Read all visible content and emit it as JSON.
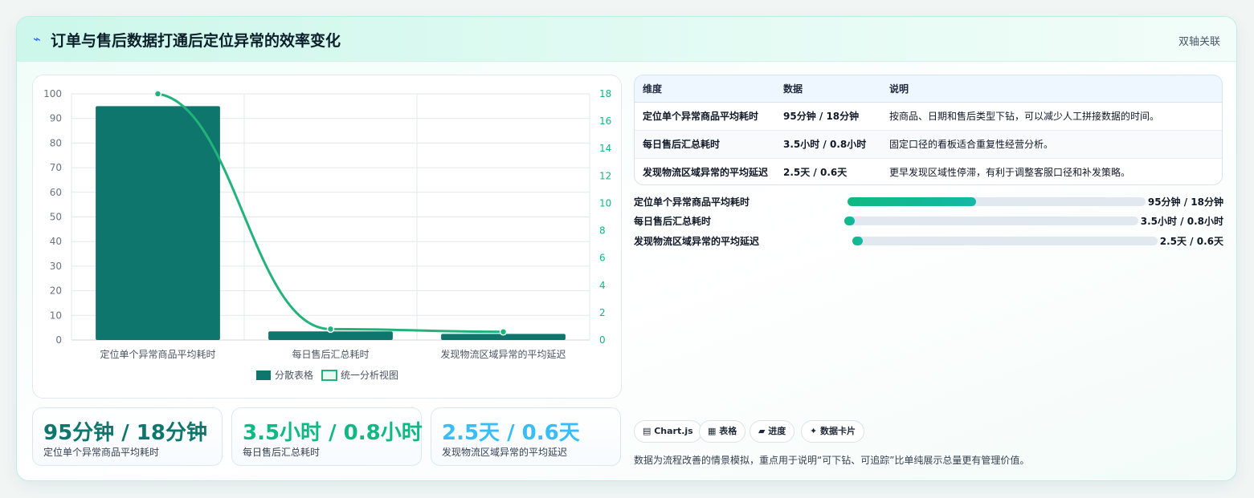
{
  "header": {
    "icon": "lightning-icon",
    "title": "订单与售后数据打通后定位异常的效率变化",
    "tag": "双轴关联"
  },
  "chart_data": {
    "type": "bar",
    "categories": [
      "定位单个异常商品平均耗时",
      "每日售后汇总耗时",
      "发现物流区域异常的平均延迟"
    ],
    "series": [
      {
        "name": "分散表格",
        "type": "bar",
        "axis": "left",
        "values": [
          95,
          3.5,
          2.5
        ],
        "color": "#0f766e"
      },
      {
        "name": "统一分析视图",
        "type": "line",
        "axis": "right",
        "values": [
          18,
          0.8,
          0.6
        ],
        "color": "#22b37a"
      }
    ],
    "y_left": {
      "min": 0,
      "max": 100,
      "ticks": [
        0,
        10,
        20,
        30,
        40,
        50,
        60,
        70,
        80,
        90,
        100
      ]
    },
    "y_right": {
      "min": 0,
      "max": 18,
      "ticks": [
        0,
        2,
        4,
        6,
        8,
        10,
        12,
        14,
        16,
        18
      ]
    },
    "legend": "bottom",
    "grid": true
  },
  "stats": [
    {
      "value": "95分钟 / 18分钟",
      "label": "定位单个异常商品平均耗时",
      "color": "#0f766e"
    },
    {
      "value": "3.5小时 / 0.8小时",
      "label": "每日售后汇总耗时",
      "color": "#10b981"
    },
    {
      "value": "2.5天 / 0.6天",
      "label": "发现物流区域异常的平均延迟",
      "color": "#38bdf8"
    }
  ],
  "table": {
    "headers": [
      "维度",
      "数据",
      "说明"
    ],
    "rows": [
      [
        "定位单个异常商品平均耗时",
        "95分钟 / 18分钟",
        "按商品、日期和售后类型下钻，可以减少人工拼接数据的时间。"
      ],
      [
        "每日售后汇总耗时",
        "3.5小时 / 0.8小时",
        "固定口径的看板适合重复性经营分析。"
      ],
      [
        "发现物流区域异常的平均延迟",
        "2.5天 / 0.6天",
        "更早发现区域性停滞，有利于调整客服口径和补发策略。"
      ]
    ]
  },
  "progress": [
    {
      "label": "定位单个异常商品平均耗时",
      "value": "95分钟 / 18分钟",
      "fraction": 0.43
    },
    {
      "label": "每日售后汇总耗时",
      "value": "3.5小时 / 0.8小时",
      "fraction": 0.03
    },
    {
      "label": "发现物流区域异常的平均延迟",
      "value": "2.5天 / 0.6天",
      "fraction": 0.03
    }
  ],
  "pills": [
    "▤ Chart.js",
    "▦ 表格",
    "▰ 进度",
    "✦ 数据卡片"
  ],
  "note": "数据为流程改善的情景模拟，重点用于说明“可下钻、可追踪”比单纯展示总量更有管理价值。"
}
